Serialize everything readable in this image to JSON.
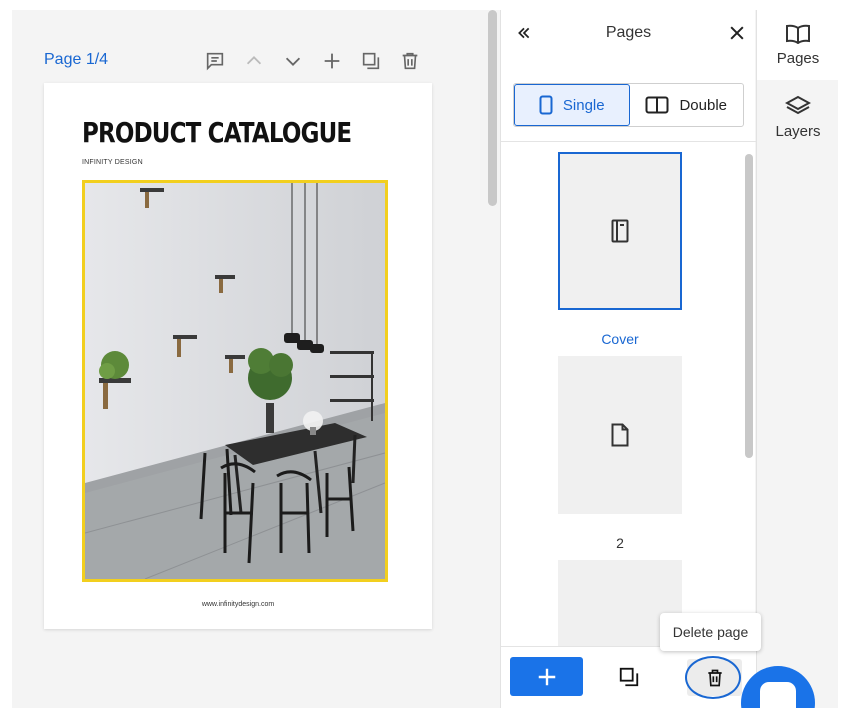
{
  "editor": {
    "page_indicator": "Page 1/4",
    "tools": {
      "notes_icon": "comment-icon",
      "move_up_icon": "chevron-up-icon",
      "move_down_icon": "chevron-down-icon",
      "add_icon": "plus-icon",
      "duplicate_icon": "duplicate-icon",
      "delete_icon": "trash-icon"
    }
  },
  "catalogue": {
    "title": "PRODUCT CATALOGUE",
    "subtitle": "INFINITY DESIGN",
    "url": "www.infinitydesign.com",
    "frame_color": "#f2cf1e"
  },
  "pages_panel": {
    "title": "Pages",
    "collapse_icon": "double-chevron-left-icon",
    "close_icon": "close-icon",
    "view_options": {
      "single": "Single",
      "double": "Double",
      "selected": "Single"
    },
    "thumbnails": [
      {
        "label": "Cover",
        "icon": "cover-page-icon",
        "selected": true
      },
      {
        "label": "2",
        "icon": "page-icon",
        "selected": false
      },
      {
        "label": "",
        "icon": "page-icon",
        "selected": false
      }
    ],
    "footer": {
      "add_icon": "plus-icon",
      "duplicate_icon": "duplicate-icon",
      "delete_icon": "trash-icon"
    },
    "tooltip": "Delete page"
  },
  "rail": {
    "items": [
      {
        "label": "Pages",
        "icon": "book-open-icon",
        "active": true
      },
      {
        "label": "Layers",
        "icon": "layers-icon",
        "active": false
      }
    ]
  },
  "colors": {
    "accent": "#1a73e8",
    "accent_text": "#1967d2",
    "panel_bg": "#f4f4f4"
  }
}
